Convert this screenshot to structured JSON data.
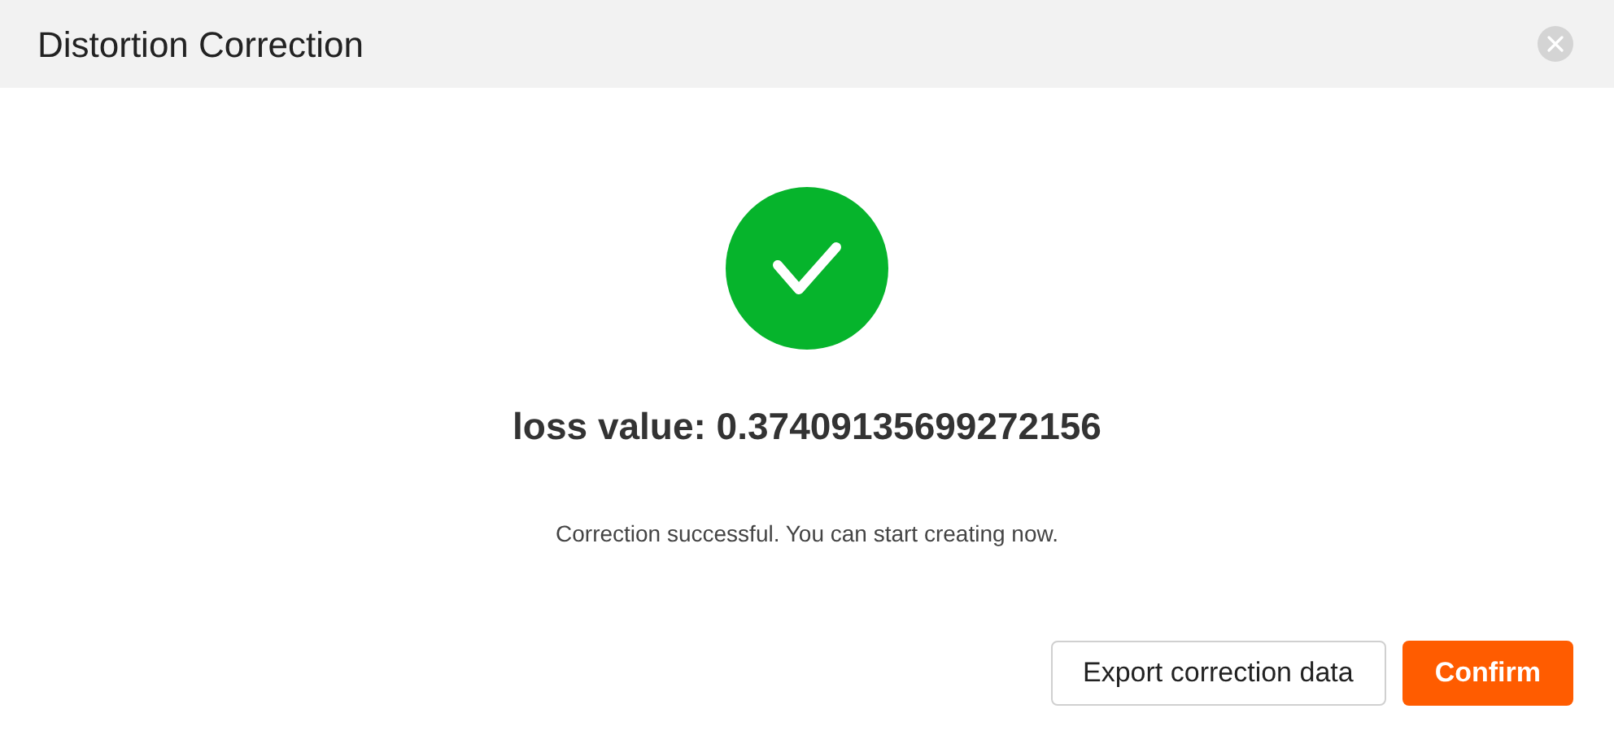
{
  "dialog": {
    "title": "Distortion Correction",
    "result": {
      "success": true,
      "value_text": "loss value: 0.37409135699272156",
      "message": "Correction successful. You can start creating now."
    },
    "buttons": [
      {
        "label": "Export correction data",
        "kind": "secondary"
      },
      {
        "label": "Confirm",
        "kind": "primary"
      }
    ]
  }
}
